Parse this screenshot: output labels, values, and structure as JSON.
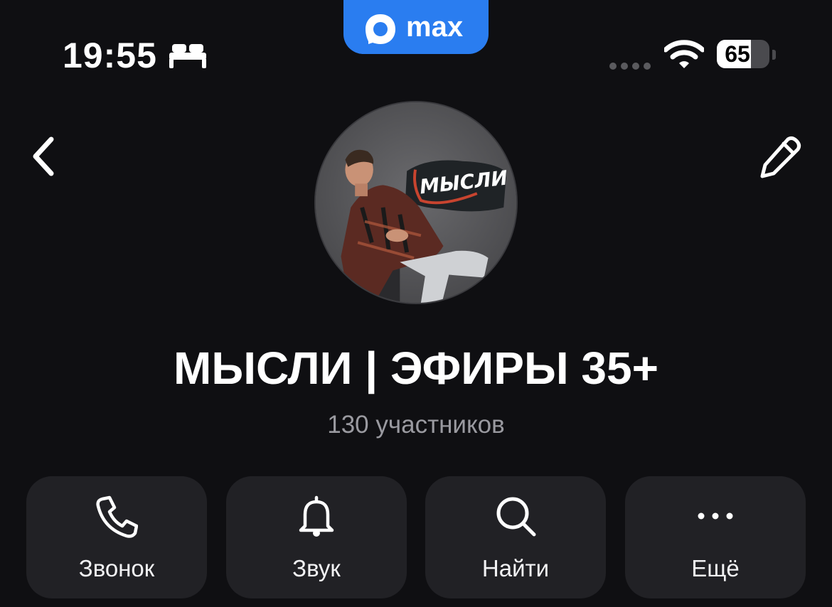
{
  "status_bar": {
    "time": "19:55",
    "focus_icon": "bed-icon",
    "battery_percent": 65,
    "battery_label": "65",
    "wifi_icon": "wifi-icon"
  },
  "app_badge": {
    "logo_icon": "max-logo-icon",
    "label": "max",
    "color": "#2a7df0"
  },
  "nav": {
    "back_icon": "chevron-left-icon",
    "edit_icon": "pencil-icon"
  },
  "chat": {
    "title": "МЫСЛИ | ЭФИРЫ 35+",
    "subtitle": "130 участников",
    "avatar_text": "МЫСЛИ"
  },
  "actions": [
    {
      "label": "Звонок",
      "icon": "phone-icon"
    },
    {
      "label": "Звук",
      "icon": "bell-icon"
    },
    {
      "label": "Найти",
      "icon": "search-icon"
    },
    {
      "label": "Ещё",
      "icon": "more-icon"
    }
  ],
  "colors": {
    "background": "#0f0f12",
    "button_bg": "#212125",
    "subtitle": "#9a9aa0",
    "accent": "#2a7df0"
  }
}
